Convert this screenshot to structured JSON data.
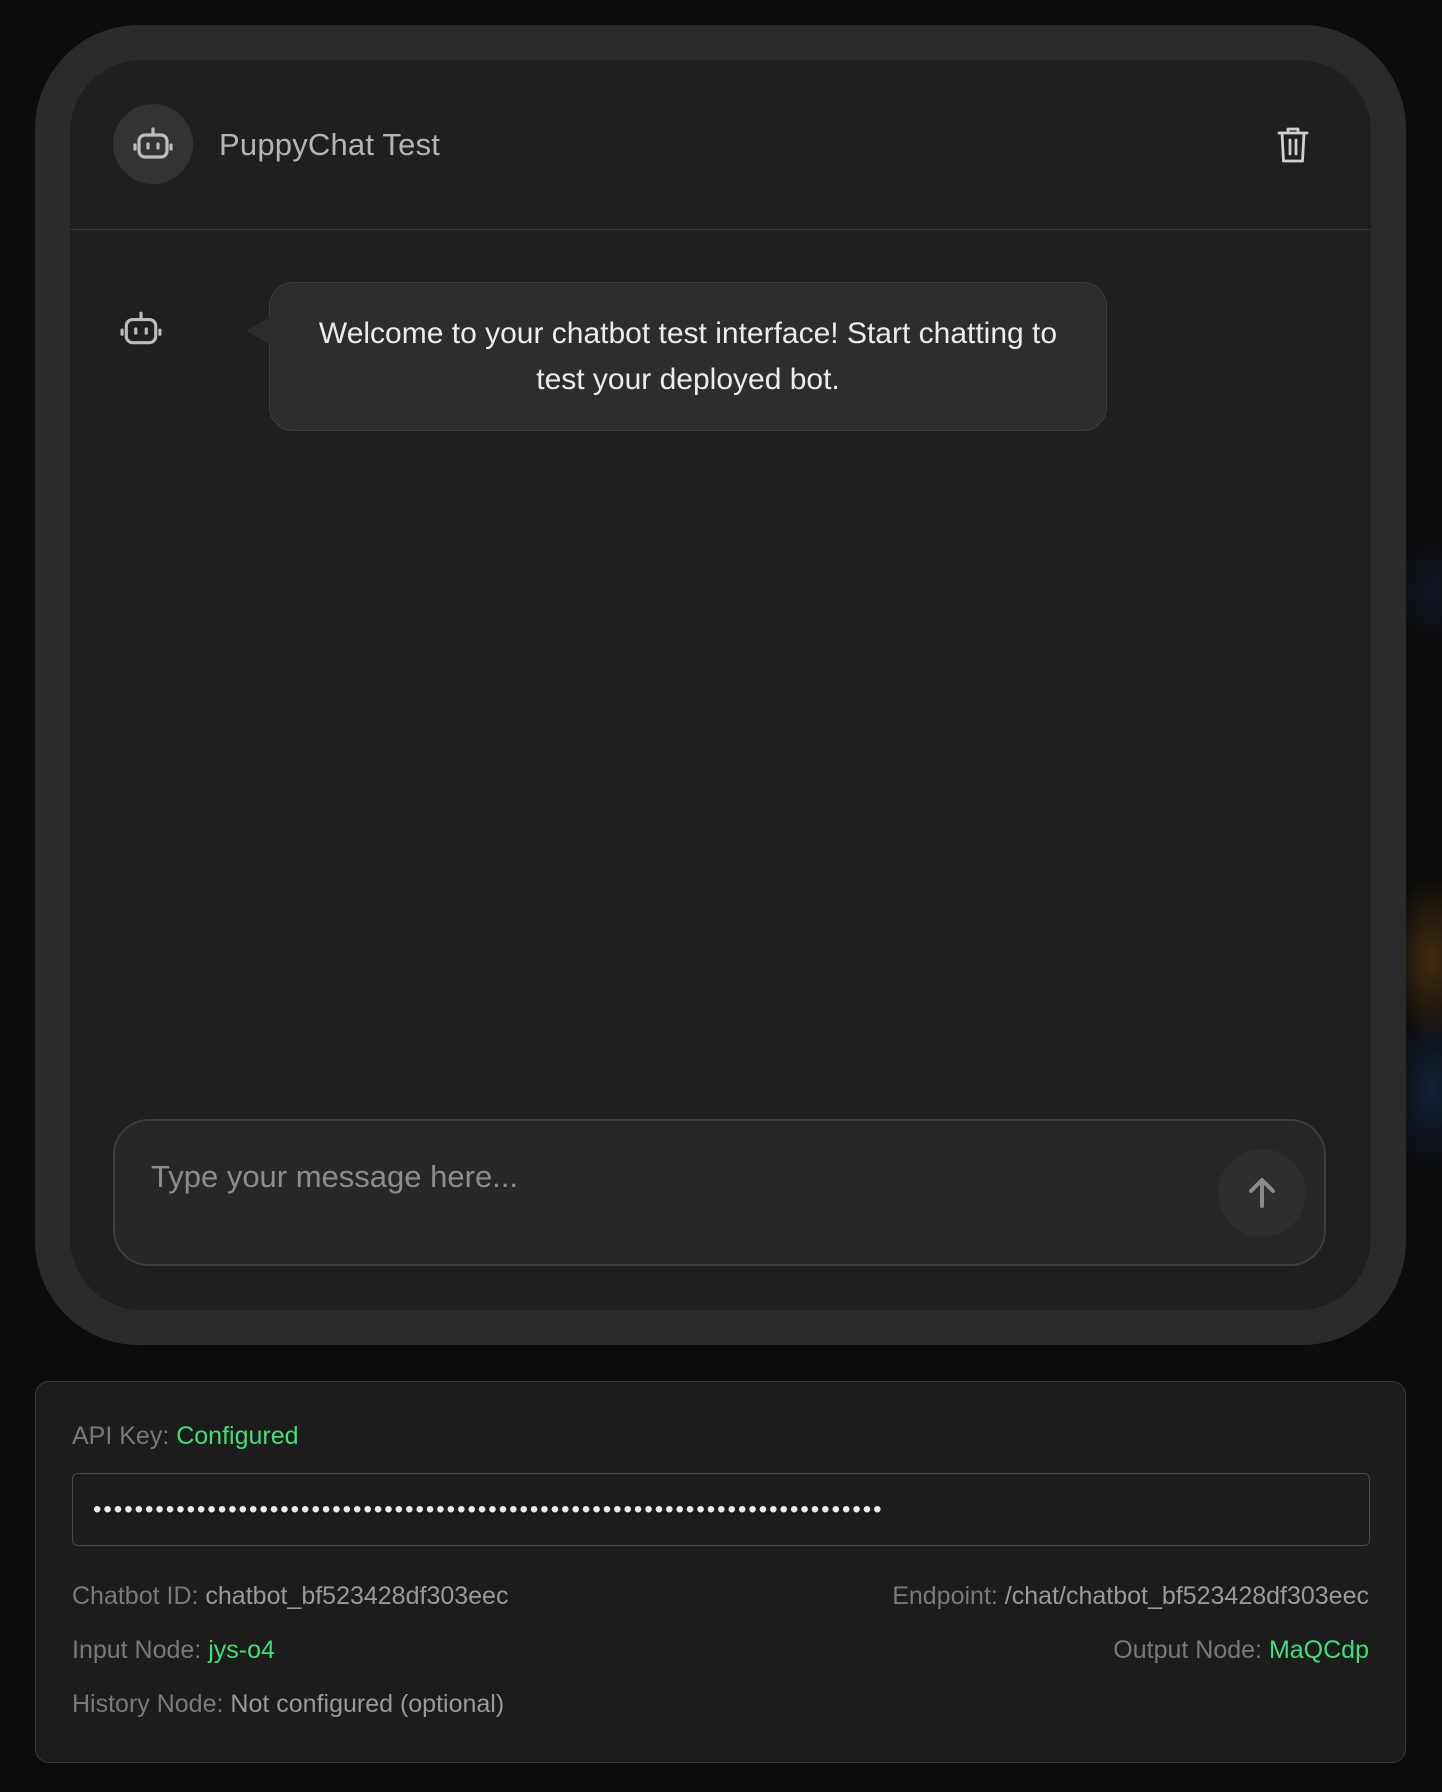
{
  "chat": {
    "title": "PuppyChat Test",
    "welcome_message": "Welcome to your chatbot test interface! Start chatting to test your deployed bot.",
    "input_placeholder": "Type your message here..."
  },
  "config": {
    "api_key_label": "API Key:",
    "api_key_status": "Configured",
    "api_key_masked": "••••••••••••••••••••••••••••••••••••••••••••••••••••••••••••••••••••••••••••",
    "chatbot_id_label": "Chatbot ID:",
    "chatbot_id": "chatbot_bf523428df303eec",
    "endpoint_label": "Endpoint:",
    "endpoint": "/chat/chatbot_bf523428df303eec",
    "input_node_label": "Input Node:",
    "input_node": "jys-o4",
    "output_node_label": "Output Node:",
    "output_node": "MaQCdp",
    "history_node_label": "History Node:",
    "history_node": "Not configured (optional)"
  },
  "icons": {
    "avatar": "robot-icon",
    "clear": "trash-icon",
    "message_avatar": "robot-icon",
    "send": "arrow-up-icon"
  },
  "colors": {
    "accent_green": "#3ee07a",
    "shell": "#2b2b2b",
    "panel": "#1f1f1f"
  }
}
